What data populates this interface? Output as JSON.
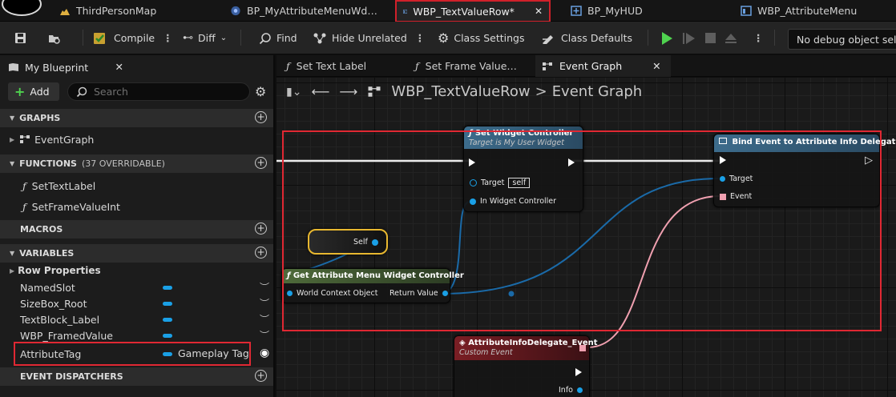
{
  "tabs": [
    {
      "label": "ThirdPersonMap",
      "icon": "level-icon"
    },
    {
      "label": "BP_MyAttributeMenuWd…",
      "icon": "blueprint-icon"
    },
    {
      "label": "WBP_TextValueRow*",
      "icon": "widget-blueprint-icon",
      "active": true
    },
    {
      "label": "BP_MyHUD",
      "icon": "hud-icon"
    },
    {
      "label": "WBP_AttributeMenu",
      "icon": "widget-blueprint-icon"
    }
  ],
  "toolbar": {
    "compile": "Compile",
    "diff": "Diff",
    "find": "Find",
    "hide_unrelated": "Hide Unrelated",
    "class_settings": "Class Settings",
    "class_defaults": "Class Defaults",
    "debug_object": "No debug object selected"
  },
  "left_panel": {
    "tab_label": "My Blueprint",
    "add_label": "Add",
    "search_placeholder": "Search",
    "sections": {
      "graphs": "GRAPHS",
      "functions": "FUNCTIONS",
      "functions_sub": "(37 OVERRIDABLE)",
      "macros": "MACROS",
      "variables": "VARIABLES",
      "event_dispatchers": "EVENT DISPATCHERS"
    },
    "graphs": [
      "EventGraph"
    ],
    "functions": [
      "SetTextLabel",
      "SetFrameValueInt"
    ],
    "variable_category": "Row Properties",
    "variables": [
      {
        "name": "NamedSlot",
        "type": ""
      },
      {
        "name": "SizeBox_Root",
        "type": ""
      },
      {
        "name": "TextBlock_Label",
        "type": ""
      },
      {
        "name": "WBP_FramedValue",
        "type": ""
      },
      {
        "name": "AttributeTag",
        "type": "Gameplay Tag"
      }
    ]
  },
  "graph_tabs": [
    {
      "label": "Set Text Label",
      "icon": "function-icon"
    },
    {
      "label": "Set Frame Value…",
      "icon": "function-icon"
    },
    {
      "label": "Event Graph",
      "icon": "event-graph-icon",
      "active": true
    }
  ],
  "breadcrumb": {
    "blueprint": "WBP_TextValueRow",
    "separator": ">",
    "graph": "Event Graph"
  },
  "nodes": {
    "set_widget_controller": {
      "title": "Set Widget Controller",
      "subtitle": "Target is My User Widget",
      "target_label": "Target",
      "target_value": "self",
      "in_widget_controller": "In Widget Controller"
    },
    "bind_event": {
      "title": "Bind Event to Attribute Info Delegate",
      "target_label": "Target",
      "event_label": "Event"
    },
    "self_node": {
      "label": "Self"
    },
    "get_controller": {
      "title": "Get Attribute Menu Widget Controller",
      "world_context": "World Context Object",
      "return_value": "Return Value"
    },
    "custom_event": {
      "title": "AttributeInfoDelegate_Event",
      "subtitle": "Custom Event",
      "info_label": "Info"
    }
  },
  "colors": {
    "highlight_red": "#e02833",
    "pin_object_blue": "#1aa0e6",
    "pin_delegate_pink": "#f0a0b0",
    "play_green": "#4fd34f",
    "function_header_blue": "#3d6c8c",
    "event_header_red": "#7a1e24",
    "pure_header_green": "#4e6a3a"
  }
}
